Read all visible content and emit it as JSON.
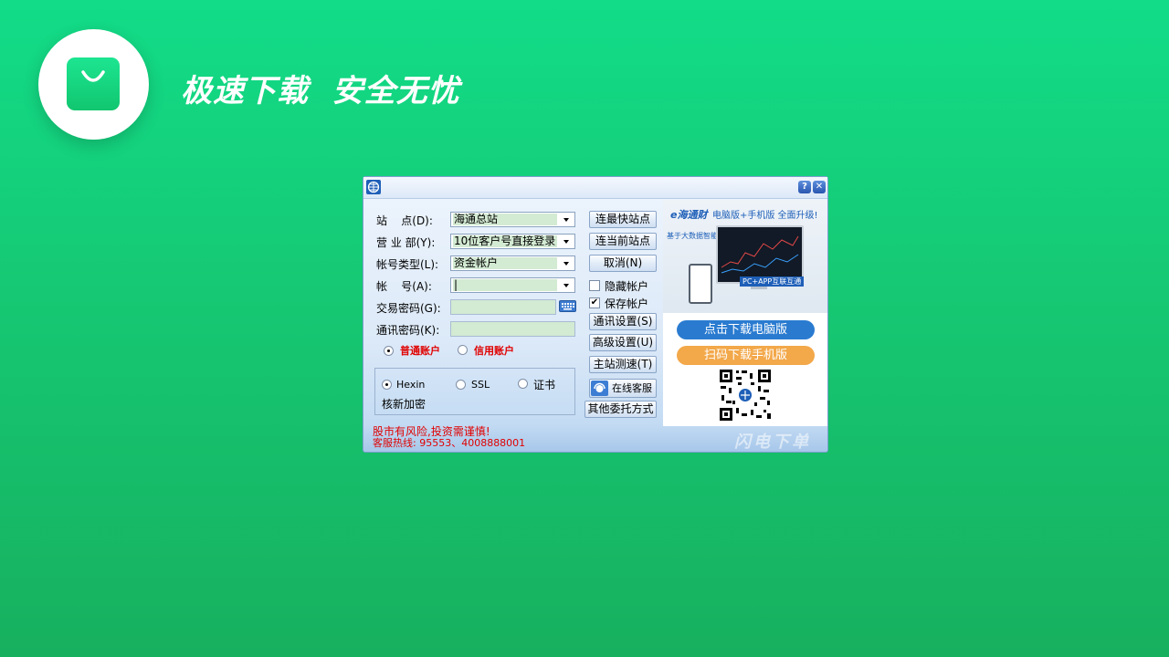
{
  "slogan": "极速下载  安全无忧",
  "dialog": {
    "help_icon": "?",
    "close_icon": "✕",
    "labels": {
      "site": "站    点(D):",
      "branch": "营 业 部(Y):",
      "account_type": "帐号类型(L):",
      "account": "帐    号(A):",
      "trade_pwd": "交易密码(G):",
      "comm_pwd": "通讯密码(K):"
    },
    "site_value": "海通总站",
    "branch_value": "10位客户号直接登录",
    "account_type_value": "资金帐户",
    "account_value": "|",
    "radio_normal": "普通账户",
    "radio_credit": "信用账户",
    "enc_hexin": "Hexin",
    "enc_ssl": "SSL",
    "enc_cert": "证书",
    "verify_encrypt": "核新加密",
    "risk_notice": "股市有风险,投资需谨慎!",
    "hotline": "客服热线: 95553、4008888001",
    "buttons": {
      "fastest": "连最快站点",
      "current": "连当前站点",
      "cancel": "取消(N)",
      "comm_settings": "通讯设置(S)",
      "advanced": "高级设置(U)",
      "speed_test": "主站测速(T)",
      "online_service": "在线客服",
      "other": "其他委托方式"
    },
    "hide_account": "隐藏帐户",
    "save_account": "保存帐户",
    "save_checked": "✔",
    "ad": {
      "brand": "e海通财",
      "headline": "电脑版+手机版 全面升级!",
      "tagline": "基于大数据智能化投资",
      "pc_app": "PC+APP互联互通",
      "download_pc": "点击下载电脑版",
      "download_mobile": "扫码下载手机版"
    },
    "footer_brand": "闪电下单"
  },
  "colors": {
    "bg_top": "#12dc88",
    "bg_bottom": "#17b05f",
    "pill_blue": "#2a7bd0",
    "pill_orange": "#f3a84a",
    "warning_red": "#e00000"
  }
}
